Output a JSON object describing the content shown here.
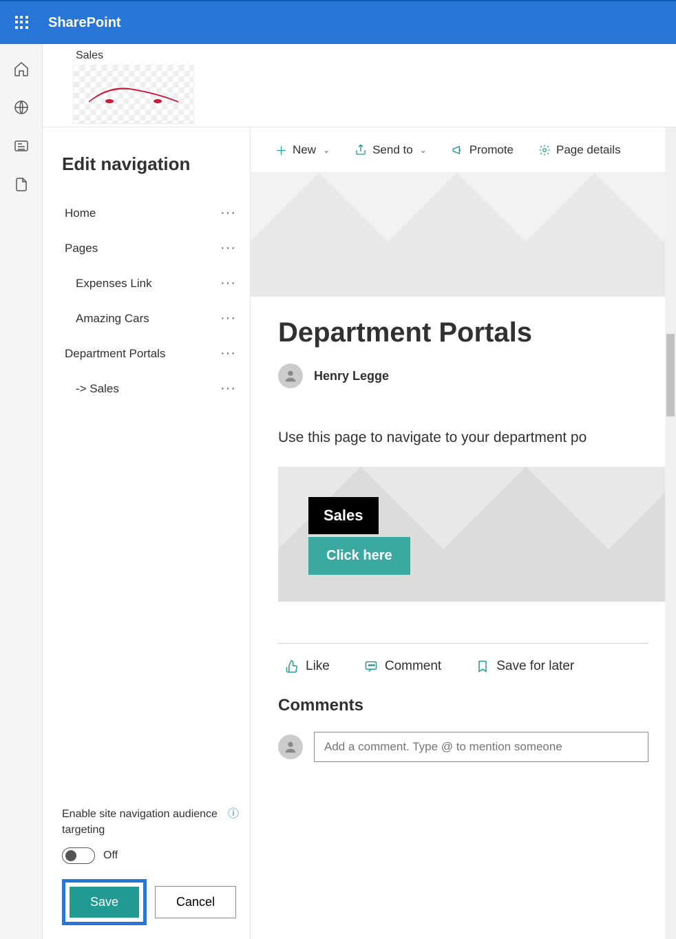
{
  "suite": {
    "app_name": "SharePoint"
  },
  "site": {
    "label": "Sales"
  },
  "nav": {
    "title": "Edit navigation",
    "items": [
      {
        "label": "Home",
        "indent": false
      },
      {
        "label": "Pages",
        "indent": false
      },
      {
        "label": "Expenses Link",
        "indent": true
      },
      {
        "label": "Amazing Cars",
        "indent": true
      },
      {
        "label": "Department Portals",
        "indent": false
      },
      {
        "label": "-> Sales",
        "indent": true
      }
    ],
    "audience_label": "Enable site navigation audience targeting",
    "toggle_state": "Off",
    "save_label": "Save",
    "cancel_label": "Cancel"
  },
  "cmd": {
    "new": "New",
    "send_to": "Send to",
    "promote": "Promote",
    "page_details": "Page details"
  },
  "page": {
    "title": "Department Portals",
    "author": "Henry Legge",
    "description": "Use this page to navigate to your department po",
    "cta_tag": "Sales",
    "cta_button": "Click here"
  },
  "social": {
    "like": "Like",
    "comment": "Comment",
    "save": "Save for later"
  },
  "comments": {
    "title": "Comments",
    "placeholder": "Add a comment. Type @ to mention someone"
  }
}
